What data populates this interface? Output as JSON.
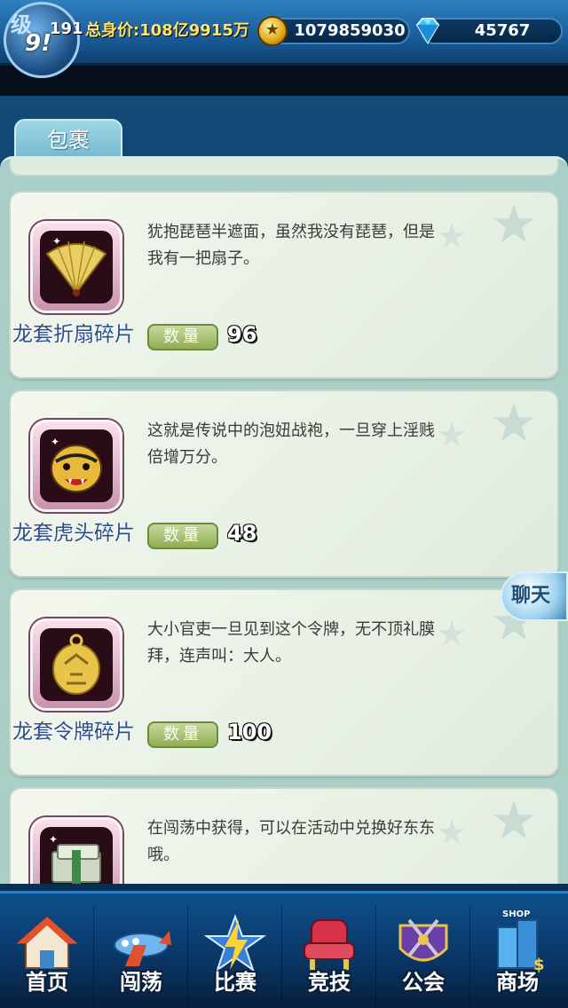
{
  "header": {
    "level_tag": "级",
    "level_number": "191",
    "vip_badge": "9!",
    "networth_label": "总身价:108亿9915万",
    "gold": "1079859030",
    "gems": "45767"
  },
  "package": {
    "tab_label": "包裹",
    "items": [
      {
        "name": "龙套折扇碎片",
        "description": "犹抱琵琶半遮面，虽然我没有琵琶，但是我有一把扇子。",
        "quantity_label": "数量",
        "quantity": "96",
        "icon": "folding-fan-icon"
      },
      {
        "name": "龙套虎头碎片",
        "description": "这就是传说中的泡妞战袍，一旦穿上淫贱倍增万分。",
        "quantity_label": "数量",
        "quantity": "48",
        "icon": "tiger-head-icon"
      },
      {
        "name": "龙套令牌碎片",
        "description": "大小官吏一旦见到这个令牌，无不顶礼膜拜，连声叫：大人。",
        "quantity_label": "数量",
        "quantity": "100",
        "icon": "gold-token-icon"
      },
      {
        "name": "",
        "description": "在闯荡中获得，可以在活动中兑换好东东哦。",
        "quantity_label": "",
        "quantity": "",
        "icon": "cash-stack-icon"
      }
    ]
  },
  "chat_button": "聊天",
  "nav": [
    {
      "label": "首页",
      "icon": "home-icon"
    },
    {
      "label": "闯荡",
      "icon": "airplane-icon"
    },
    {
      "label": "比赛",
      "icon": "lightning-star-icon"
    },
    {
      "label": "竞技",
      "icon": "armchair-icon"
    },
    {
      "label": "公会",
      "icon": "guild-emblem-icon"
    },
    {
      "label": "商场",
      "icon": "shop-icon"
    }
  ],
  "shop_tag": "SHOP",
  "colors": {
    "nav_bg": "#093563",
    "panel_bg": "#a9cfc6",
    "item_name": "#2a4e8f",
    "networth": "#ffe36a"
  }
}
